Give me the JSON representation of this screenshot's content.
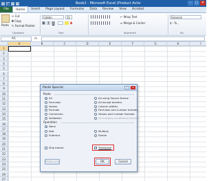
{
  "window": {
    "title": "Book2 - Microsoft Excel (Product Activ"
  },
  "ribbon_tabs": [
    "File",
    "Home",
    "Insert",
    "Page Layout",
    "Formulas",
    "Data",
    "Review",
    "View",
    "Acrobat"
  ],
  "clipboard": {
    "cut": "Cut",
    "copy": "Copy",
    "format_painter": "Format Painter",
    "paste": "Paste",
    "group": "Clipboard"
  },
  "font": {
    "name": "Calibri",
    "size": "11",
    "bold": "B",
    "italic": "I",
    "underline": "U",
    "group": "Font"
  },
  "alignment": {
    "wrap_text": "Wrap Text",
    "merge_center": "Merge & Center",
    "group": "Alignment"
  },
  "number": {
    "format": "General",
    "group": "Nu"
  },
  "formula_bar": {
    "name_box": "A1",
    "fx": "fx",
    "value": ""
  },
  "columns": [
    "A",
    "B",
    "C",
    "D",
    "E",
    "F",
    "G",
    "H",
    "I"
  ],
  "rows": [
    "1",
    "2",
    "3",
    "4",
    "5",
    "6",
    "7",
    "8",
    "9",
    "10",
    "11",
    "12",
    "13",
    "14",
    "15",
    "16",
    "17",
    "18",
    "19",
    "20",
    "21",
    "22",
    "23",
    "24",
    "25",
    "26",
    "27"
  ],
  "dialog": {
    "title": "Paste Special",
    "help": "?",
    "close": "x",
    "paste_label": "Paste",
    "paste_left": [
      {
        "label": "All",
        "selected": true
      },
      {
        "label": "Formulas",
        "selected": false
      },
      {
        "label": "Values",
        "selected": false
      },
      {
        "label": "Formats",
        "selected": false
      },
      {
        "label": "Comments",
        "selected": false
      },
      {
        "label": "Validation",
        "selected": false
      }
    ],
    "paste_right": [
      {
        "label": "All using Source theme",
        "selected": false,
        "disabled": false
      },
      {
        "label": "All except borders",
        "selected": false,
        "disabled": false
      },
      {
        "label": "Column widths",
        "selected": false,
        "disabled": false
      },
      {
        "label": "Formulas and number formats",
        "selected": false,
        "disabled": false
      },
      {
        "label": "Values and number formats",
        "selected": false,
        "disabled": false
      },
      {
        "label": "All merging conditional formats",
        "selected": false,
        "disabled": true
      }
    ],
    "operation_label": "Operation",
    "op_left": [
      {
        "label": "None",
        "selected": true
      },
      {
        "label": "Add",
        "selected": false
      },
      {
        "label": "Subtract",
        "selected": false
      }
    ],
    "op_right": [
      {
        "label": "Multiply",
        "selected": false
      },
      {
        "label": "Divide",
        "selected": false
      }
    ],
    "skip_blanks": {
      "label": "Skip blanks",
      "checked": false
    },
    "transpose": {
      "label": "Transpose",
      "checked": true
    },
    "paste_link": "Paste Link",
    "ok": "OK",
    "cancel": "Cancel",
    "highlight_color": "#e02a2a"
  }
}
